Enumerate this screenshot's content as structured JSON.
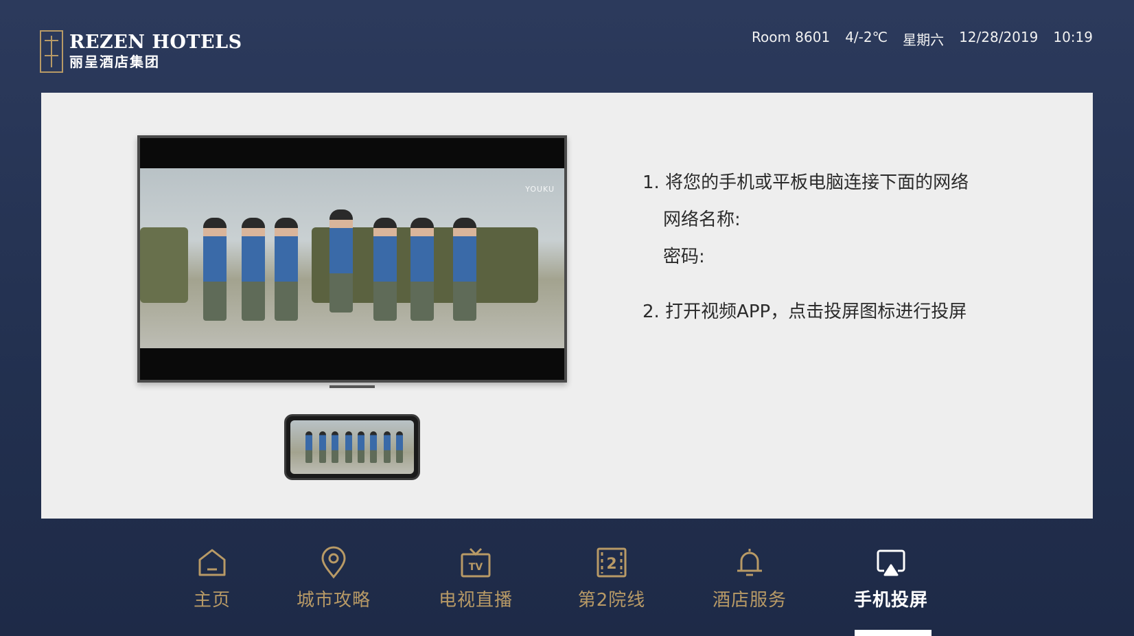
{
  "header": {
    "brand_en": "REZEN HOTELS",
    "brand_cn": "丽呈酒店集团",
    "room": "Room 8601",
    "weather": "4/-2℃",
    "weekday": "星期六",
    "date": "12/28/2019",
    "time": "10:19"
  },
  "screen_cast": {
    "video_watermark": "YOUKU",
    "steps": [
      {
        "text": "1. 将您的手机或平板电脑连接下面的网络"
      },
      {
        "text": "网络名称:"
      },
      {
        "text": "密码:"
      },
      {
        "text": "2. 打开视频APP，点击投屏图标进行投屏"
      }
    ]
  },
  "nav": {
    "active_index": 5,
    "accent_color": "#b89a66",
    "items": [
      {
        "label": "主页",
        "icon": "home-icon"
      },
      {
        "label": "城市攻略",
        "icon": "location-pin-icon"
      },
      {
        "label": "电视直播",
        "icon": "tv-icon"
      },
      {
        "label": "第2院线",
        "icon": "cinema-2-icon"
      },
      {
        "label": "酒店服务",
        "icon": "bell-icon"
      },
      {
        "label": "手机投屏",
        "icon": "screen-cast-icon"
      }
    ]
  }
}
